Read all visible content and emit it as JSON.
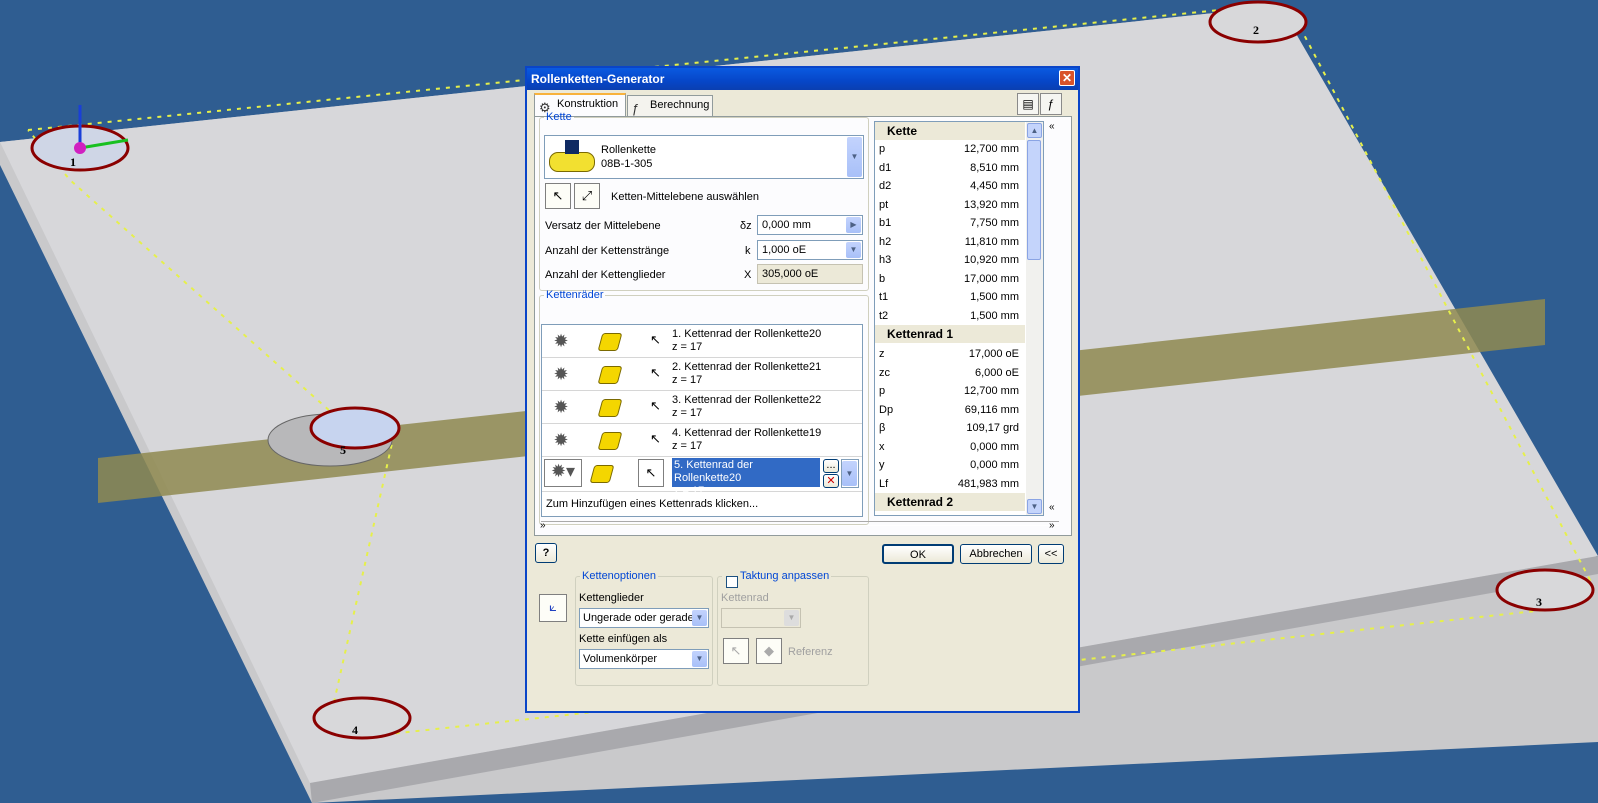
{
  "dialog": {
    "title": "Rollenketten-Generator",
    "close_glyph": "✕",
    "tabs": [
      {
        "label": "Konstruktion",
        "icon": "chain-icon"
      },
      {
        "label": "Berechnung",
        "icon": "formula-icon"
      }
    ],
    "chain_group": {
      "legend": "Kette",
      "chain_name": "Rollenkette",
      "chain_code": "08B-1-305",
      "select_plane_label": "Ketten-Mittelebene auswählen",
      "offset_label": "Versatz der Mittelebene",
      "offset_symbol": "δz",
      "offset_value": "0,000 mm",
      "strands_label": "Anzahl der Kettenstränge",
      "strands_symbol": "k",
      "strands_value": "1,000 oE",
      "links_label": "Anzahl der Kettenglieder",
      "links_symbol": "X",
      "links_value": "305,000 oE"
    },
    "sprockets_group": {
      "legend": "Kettenräder",
      "rows": [
        {
          "title": "1. Kettenrad der Rollenkette20",
          "teeth": "z = 17"
        },
        {
          "title": "2. Kettenrad der Rollenkette21",
          "teeth": "z = 17"
        },
        {
          "title": "3. Kettenrad der Rollenkette22",
          "teeth": "z = 17"
        },
        {
          "title": "4. Kettenrad der Rollenkette19",
          "teeth": "z = 17"
        },
        {
          "title": "5. Kettenrad der Rollenkette20",
          "teeth": "z = 17"
        }
      ],
      "more_btn": "...",
      "add_hint": "Zum Hinzufügen eines Kettenrads klicken..."
    },
    "properties": {
      "sections": [
        {
          "title": "Kette",
          "rows": [
            {
              "k": "p",
              "v": "12,700 mm"
            },
            {
              "k": "d1",
              "v": "8,510 mm"
            },
            {
              "k": "d2",
              "v": "4,450 mm"
            },
            {
              "k": "pt",
              "v": "13,920 mm"
            },
            {
              "k": "b1",
              "v": "7,750 mm"
            },
            {
              "k": "h2",
              "v": "11,810 mm"
            },
            {
              "k": "h3",
              "v": "10,920 mm"
            },
            {
              "k": "b",
              "v": "17,000 mm"
            },
            {
              "k": "t1",
              "v": "1,500 mm"
            },
            {
              "k": "t2",
              "v": "1,500 mm"
            }
          ]
        },
        {
          "title": "Kettenrad 1",
          "rows": [
            {
              "k": "z",
              "v": "17,000 oE"
            },
            {
              "k": "zc",
              "v": "6,000 oE"
            },
            {
              "k": "p",
              "v": "12,700 mm"
            },
            {
              "k": "Dp",
              "v": "69,116 mm"
            },
            {
              "k": "β",
              "v": "109,17 grd"
            },
            {
              "k": "x",
              "v": "0,000 mm"
            },
            {
              "k": "y",
              "v": "0,000 mm"
            },
            {
              "k": "Lf",
              "v": "481,983 mm"
            }
          ]
        },
        {
          "title": "Kettenrad 2",
          "rows": []
        }
      ]
    },
    "buttons": {
      "help": "?",
      "ok": "OK",
      "cancel": "Abbrechen",
      "collapse": "<<"
    },
    "options": {
      "chain_options_legend": "Kettenoptionen",
      "links_label": "Kettenglieder",
      "links_value": "Ungerade oder gerade",
      "insert_label": "Kette einfügen als",
      "insert_value": "Volumenkörper",
      "timing_label": "Taktung anpassen",
      "timing_sprocket_label": "Kettenrad",
      "reference_label": "Referenz"
    }
  },
  "scene": {
    "sprocket_labels": [
      "1",
      "2",
      "3",
      "4",
      "5"
    ]
  }
}
